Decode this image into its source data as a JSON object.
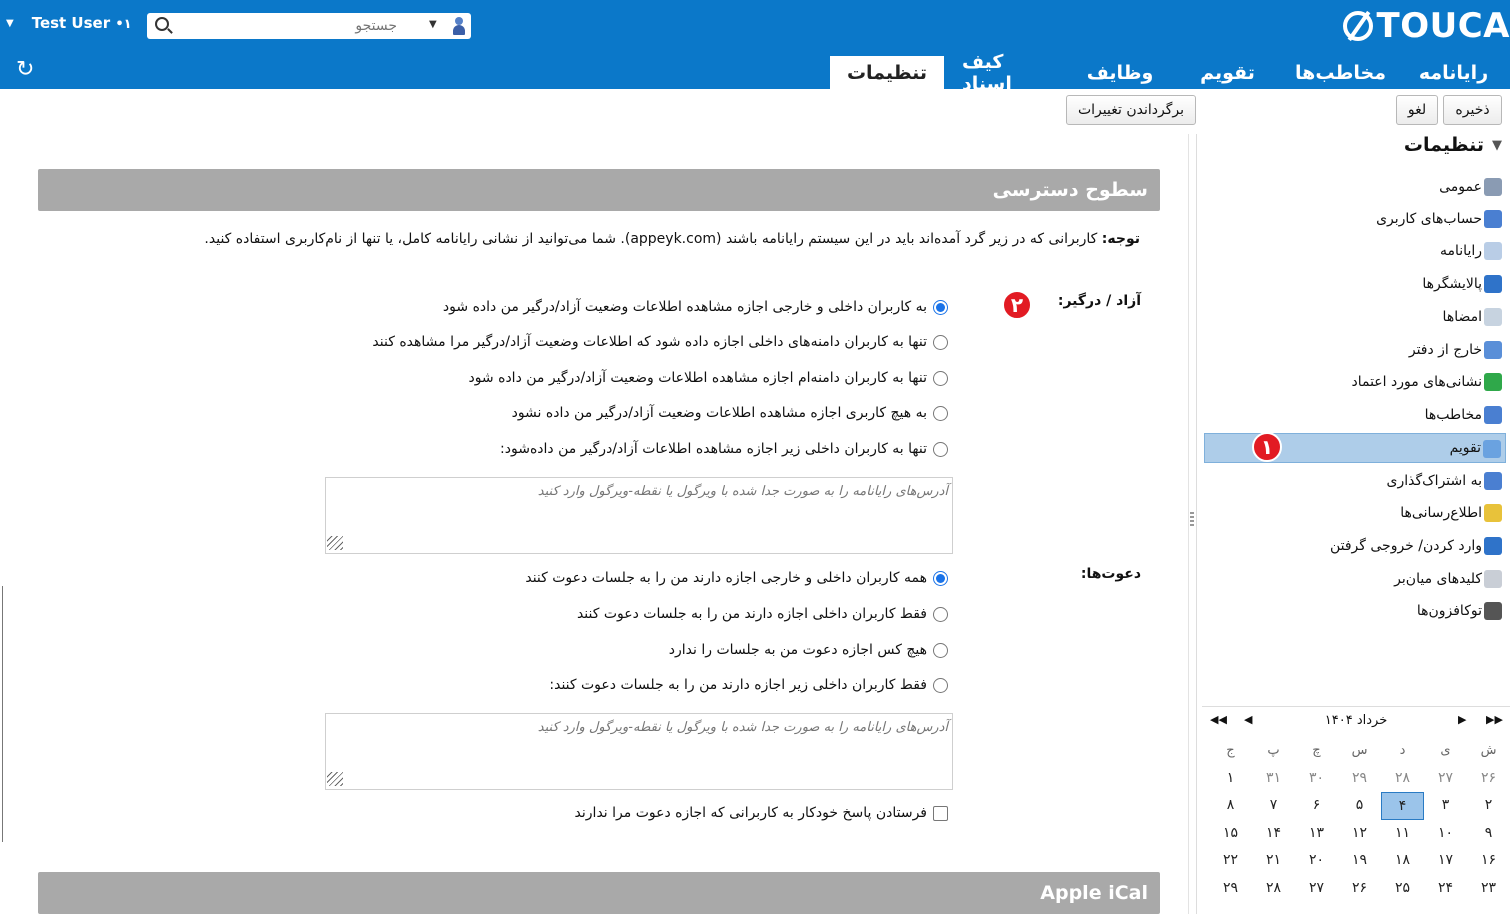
{
  "header": {
    "brand": "TOUCA",
    "user": "Test User",
    "presence": "•۱",
    "search_placeholder": "جستجو",
    "tabs": [
      "رایانامه",
      "مخاطب‌ها",
      "تقویم",
      "وظایف",
      "کیف اسناد",
      "تنظیمات"
    ],
    "active_tab": "تنظیمات"
  },
  "toolbar": {
    "save": "ذخیره",
    "cancel": "لغو",
    "revert": "برگرداندن تغییرات"
  },
  "sidebar": {
    "title": "تنظیمات",
    "items": [
      {
        "label": "عمومی",
        "icon": "gear-icon",
        "color": "#8a9bb3"
      },
      {
        "label": "حساب‌های کاربری",
        "icon": "user-account-icon",
        "color": "#4a7fd1"
      },
      {
        "label": "رایانامه",
        "icon": "mail-icon",
        "color": "#b9cde6"
      },
      {
        "label": "پالایشگرها",
        "icon": "filter-icon",
        "color": "#2f73c9"
      },
      {
        "label": "امضاها",
        "icon": "signature-icon",
        "color": "#c7d3e0"
      },
      {
        "label": "خارج از دفتر",
        "icon": "out-of-office-icon",
        "color": "#5a8fd8"
      },
      {
        "label": "نشانی‌های مورد اعتماد",
        "icon": "trusted-shield-icon",
        "color": "#2fa84a"
      },
      {
        "label": "مخاطب‌ها",
        "icon": "contacts-icon",
        "color": "#4a7fd1"
      },
      {
        "label": "تقویم",
        "icon": "calendar-icon",
        "color": "#6aa2e0"
      },
      {
        "label": "به اشتراک‌گذاری",
        "icon": "sharing-icon",
        "color": "#4a7fd1"
      },
      {
        "label": "اطلاع‌رسانی‌ها",
        "icon": "bell-icon",
        "color": "#e8c23a"
      },
      {
        "label": "وارد کردن/ خروجی گرفتن",
        "icon": "import-export-icon",
        "color": "#2f73c9"
      },
      {
        "label": "کلیدهای میان‌بر",
        "icon": "keyboard-icon",
        "color": "#c9ced6"
      },
      {
        "label": "توکافزون‌ها",
        "icon": "zimlet-icon",
        "color": "#555555"
      }
    ],
    "active_index": 8,
    "badge_1": "۱",
    "badge_2": "۲"
  },
  "calendar": {
    "title": "خرداد ۱۴۰۴",
    "weekdays": [
      "ش",
      "ی",
      "د",
      "س",
      "چ",
      "پ",
      "ج"
    ],
    "rows": [
      [
        "۲۶",
        "۲۷",
        "۲۸",
        "۲۹",
        "۳۰",
        "۳۱",
        "۱"
      ],
      [
        "۲",
        "۳",
        "۴",
        "۵",
        "۶",
        "۷",
        "۸"
      ],
      [
        "۹",
        "۱۰",
        "۱۱",
        "۱۲",
        "۱۳",
        "۱۴",
        "۱۵"
      ],
      [
        "۱۶",
        "۱۷",
        "۱۸",
        "۱۹",
        "۲۰",
        "۲۱",
        "۲۲"
      ],
      [
        "۲۳",
        "۲۴",
        "۲۵",
        "۲۶",
        "۲۷",
        "۲۸",
        "۲۹"
      ]
    ],
    "today": "۴"
  },
  "main": {
    "section_title": "سطوح دسترسی",
    "note_bold": "توجه:",
    "note_text": " کاربرانی که در زیر گرد آمده‌اند باید در این سیستم رایانامه باشند (appeyk.com). شما می‌توانید از نشانی رایانامه کامل، یا تنها از نام‌کاربری استفاده کنید.",
    "freebusy_label": "آزاد / درگیر:",
    "freebusy_options": [
      "به کاربران داخلی و خارجی اجازه مشاهده اطلاعات وضعیت آزاد/درگیر من داده شود",
      "تنها به کاربران دامنه‌های داخلی اجازه داده شود که اطلاعات وضعیت آزاد/درگیر مرا مشاهده کنند",
      "تنها به کاربران دامنه‌ام اجازه مشاهده اطلاعات وضعیت آزاد/درگیر من داده شود",
      "به هیچ کاربری اجازه مشاهده اطلاعات وضعیت آزاد/درگیر من داده نشود",
      "تنها به کاربران داخلی زیر اجازه مشاهده اطلاعات آزاد/درگیر من داده‌شود:"
    ],
    "freebusy_selected": 0,
    "textarea_placeholder": "آدرس‌های رایانامه را به صورت جدا شده با ویرگول یا نقطه-ویرگول وارد کنید",
    "invites_label": "دعوت‌ها:",
    "invite_options": [
      "همه کاربران داخلی و خارجی اجازه دارند من را به جلسات دعوت کنند",
      "فقط کاربران داخلی اجازه دارند من را به جلسات دعوت کنند",
      "هیچ کس اجازه دعوت من به جلسات را ندارد",
      "فقط کاربران داخلی زیر اجازه دارند من را به جلسات دعوت کنند:"
    ],
    "invite_selected": 0,
    "auto_reply": "فرستادن پاسخ خودکار به کاربرانی که اجازه دعوت مرا ندارند",
    "section2_title": "Apple iCal"
  }
}
